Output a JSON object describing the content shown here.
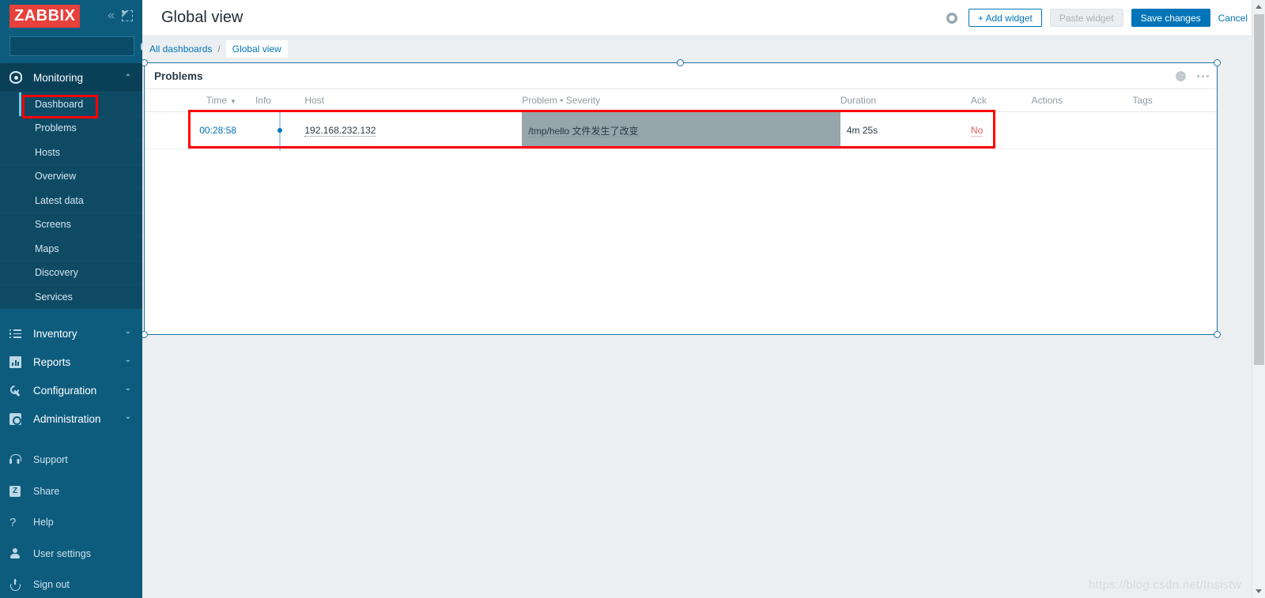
{
  "app": {
    "logo_text": "ZABBIX",
    "collapse_icon": "chevrons-left-icon",
    "compact_icon": "compact-view-icon"
  },
  "search": {
    "value": "",
    "placeholder": ""
  },
  "sidebar": {
    "sections": [
      {
        "label": "Monitoring",
        "icon": "eye-icon",
        "expanded": true,
        "chevron": "chevron-up-icon",
        "items": [
          {
            "label": "Dashboard",
            "active": true,
            "annotated": true
          },
          {
            "label": "Problems",
            "active": false
          },
          {
            "label": "Hosts",
            "active": false
          },
          {
            "label": "Overview",
            "active": false
          },
          {
            "label": "Latest data",
            "active": false
          },
          {
            "label": "Screens",
            "active": false
          },
          {
            "label": "Maps",
            "active": false
          },
          {
            "label": "Discovery",
            "active": false
          },
          {
            "label": "Services",
            "active": false
          }
        ]
      },
      {
        "label": "Inventory",
        "icon": "list-icon",
        "expanded": false,
        "chevron": "chevron-down-icon",
        "items": []
      },
      {
        "label": "Reports",
        "icon": "bar-chart-icon",
        "expanded": false,
        "chevron": "chevron-down-icon",
        "items": []
      },
      {
        "label": "Configuration",
        "icon": "wrench-icon",
        "expanded": false,
        "chevron": "chevron-down-icon",
        "items": []
      },
      {
        "label": "Administration",
        "icon": "gear-square-icon",
        "expanded": false,
        "chevron": "chevron-down-icon",
        "items": []
      }
    ],
    "footer": [
      {
        "label": "Support",
        "icon": "headset-icon"
      },
      {
        "label": "Share",
        "icon": "zabbix-share-icon"
      },
      {
        "label": "Help",
        "icon": "question-mark-icon"
      },
      {
        "label": "User settings",
        "icon": "person-icon"
      },
      {
        "label": "Sign out",
        "icon": "power-icon"
      }
    ]
  },
  "header": {
    "title": "Global view",
    "gear_icon": "gear-icon",
    "buttons": {
      "add_widget": "+ Add widget",
      "paste_widget": "Paste widget",
      "save_changes": "Save changes",
      "cancel": "Cancel"
    }
  },
  "breadcrumb": {
    "root": "All dashboards",
    "separator": "/",
    "current": "Global view"
  },
  "widget": {
    "title": "Problems",
    "gear_icon": "gear-icon",
    "menu_icon": "ellipsis-icon",
    "columns": [
      "Time",
      "Info",
      "Host",
      "Problem • Severity",
      "Duration",
      "Ack",
      "Actions",
      "Tags"
    ],
    "sort_column": "Time",
    "sort_indicator": "▼",
    "rows": [
      {
        "time": "00:28:58",
        "info": "info-dot-icon",
        "host": "192.168.232.132",
        "problem": "/tmp/hello 文件发生了改变",
        "duration": "4m 25s",
        "ack": "No",
        "actions": "",
        "tags": ""
      }
    ]
  },
  "colors": {
    "brand_red": "#e8403a",
    "sidebar_bg": "#0d5c7e",
    "accent_blue": "#0275b8",
    "widget_border": "#1b74a3",
    "severity_bg": "#97a5ac",
    "ack_no": "#e45959",
    "annotation": "#ff0000"
  },
  "watermark": "https://blog.csdn.net/Insistw"
}
